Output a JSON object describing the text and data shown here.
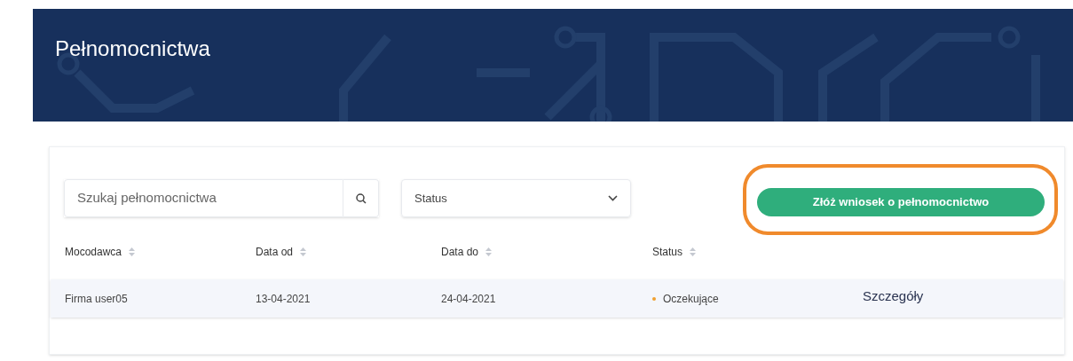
{
  "header": {
    "title": "Pełnomocnictwa"
  },
  "search": {
    "placeholder": "Szukaj pełnomocnictwa"
  },
  "status_filter": {
    "value": "Status"
  },
  "apply_button": {
    "label": "Złóż wniosek o pełnomocnictwo",
    "highlighted": true
  },
  "table": {
    "columns": [
      "Mocodawca",
      "Data od",
      "Data do",
      "Status"
    ],
    "rows": [
      {
        "principal": "Firma user05",
        "date_from": "13-04-2021",
        "date_to": "24-04-2021",
        "status": "Oczekujące",
        "color": "#f0a030",
        "action": "Szczegóły"
      }
    ]
  }
}
